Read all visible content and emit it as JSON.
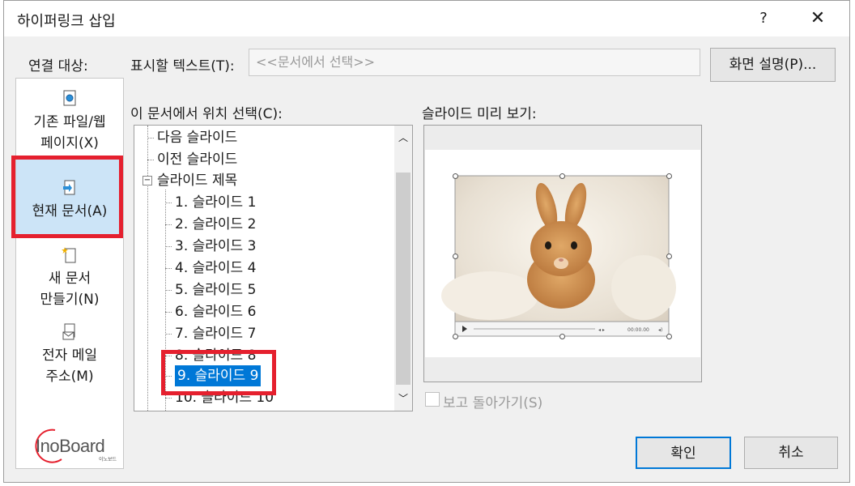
{
  "window": {
    "title": "하이퍼링크 삽입",
    "help": "?",
    "close": "✕"
  },
  "link_to": {
    "label": "연결 대상:",
    "items": [
      {
        "line1": "기존 파일/웹",
        "line2": "페이지(X)",
        "icon": "file-web-icon"
      },
      {
        "line1": "현재 문서(A)",
        "line2": "",
        "icon": "current-doc-icon"
      },
      {
        "line1": "새 문서",
        "line2": "만들기(N)",
        "icon": "new-doc-icon"
      },
      {
        "line1": "전자 메일",
        "line2": "주소(M)",
        "icon": "email-icon"
      }
    ],
    "selected_index": 1
  },
  "display_text": {
    "label": "표시할 텍스트(T):",
    "value": "<<문서에서 선택>>"
  },
  "screentip_button": "화면 설명(P)...",
  "place_in_doc": {
    "label": "이 문서에서 위치 선택(C):",
    "items": [
      "다음 슬라이드",
      "이전 슬라이드",
      "슬라이드 제목",
      "1. 슬라이드 1",
      "2. 슬라이드 2",
      "3. 슬라이드 3",
      "4. 슬라이드 4",
      "5. 슬라이드 5",
      "6. 슬라이드 6",
      "7. 슬라이드 7",
      "8. 슬라이드 8",
      "9. 슬라이드 9",
      "10. 슬라이드 10"
    ],
    "selected": "9. 슬라이드 9"
  },
  "preview": {
    "label": "슬라이드 미리 보기:",
    "video_time": "00:00.00"
  },
  "show_and_return": {
    "label": "보고 돌아가기(S)",
    "checked": false
  },
  "buttons": {
    "ok": "확인",
    "cancel": "취소"
  },
  "watermark": {
    "text": "InoBoard",
    "sub": "이노보드"
  },
  "colors": {
    "highlight": "#0078d7",
    "selection": "#cce4f7",
    "annotation_red": "#e5202e"
  }
}
